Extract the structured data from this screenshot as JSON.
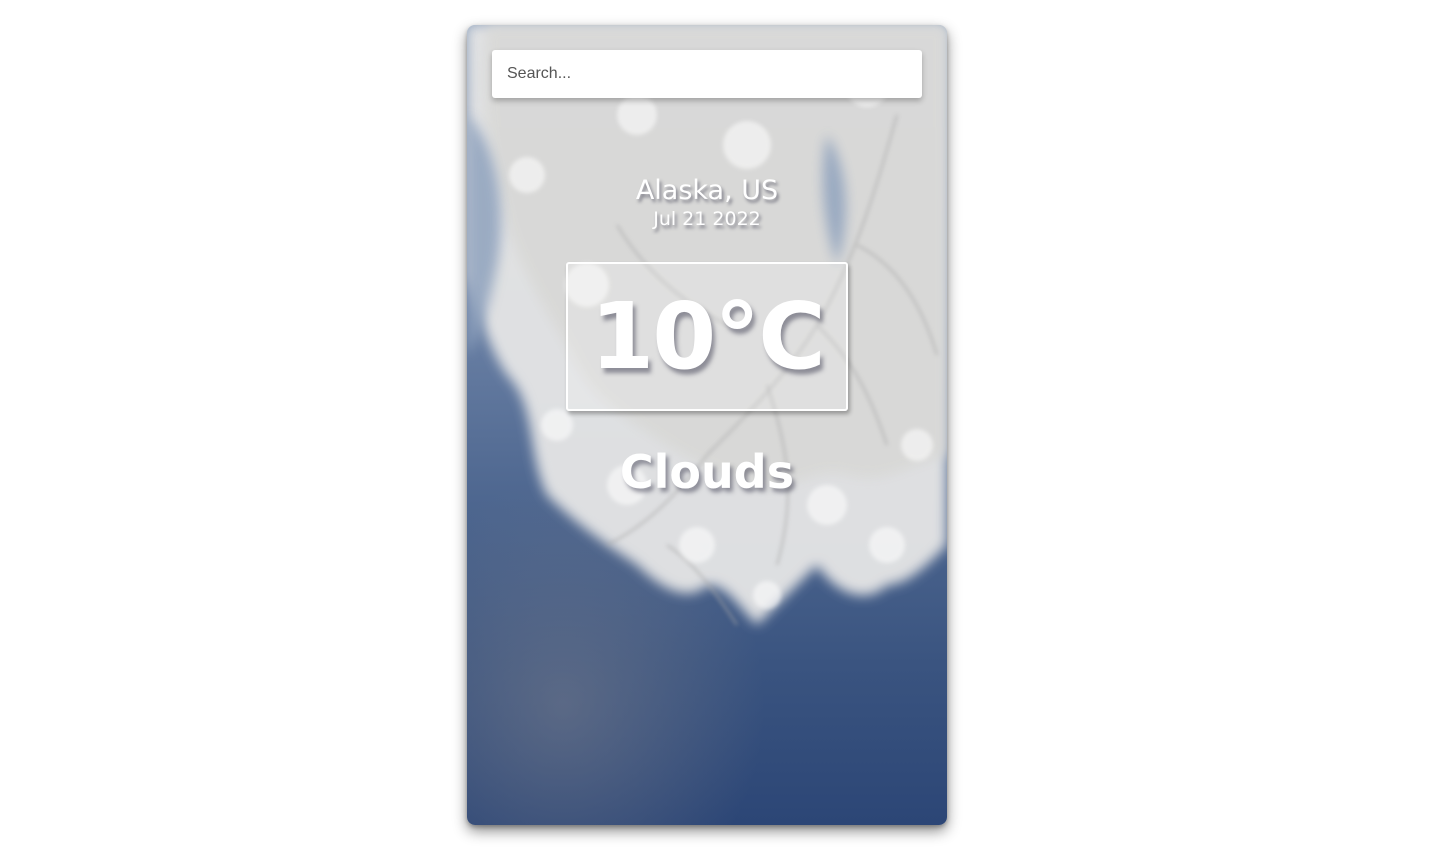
{
  "search": {
    "placeholder": "Search...",
    "value": ""
  },
  "location": {
    "name": "Alaska, US",
    "date": "Jul 21 2022"
  },
  "weather": {
    "temperature": "10°C",
    "condition": "Clouds"
  },
  "colors": {
    "sky_top": "#8fa2bd",
    "sky_bottom": "#2c4676",
    "frost": "#eeeeee",
    "text": "#ffffff"
  }
}
